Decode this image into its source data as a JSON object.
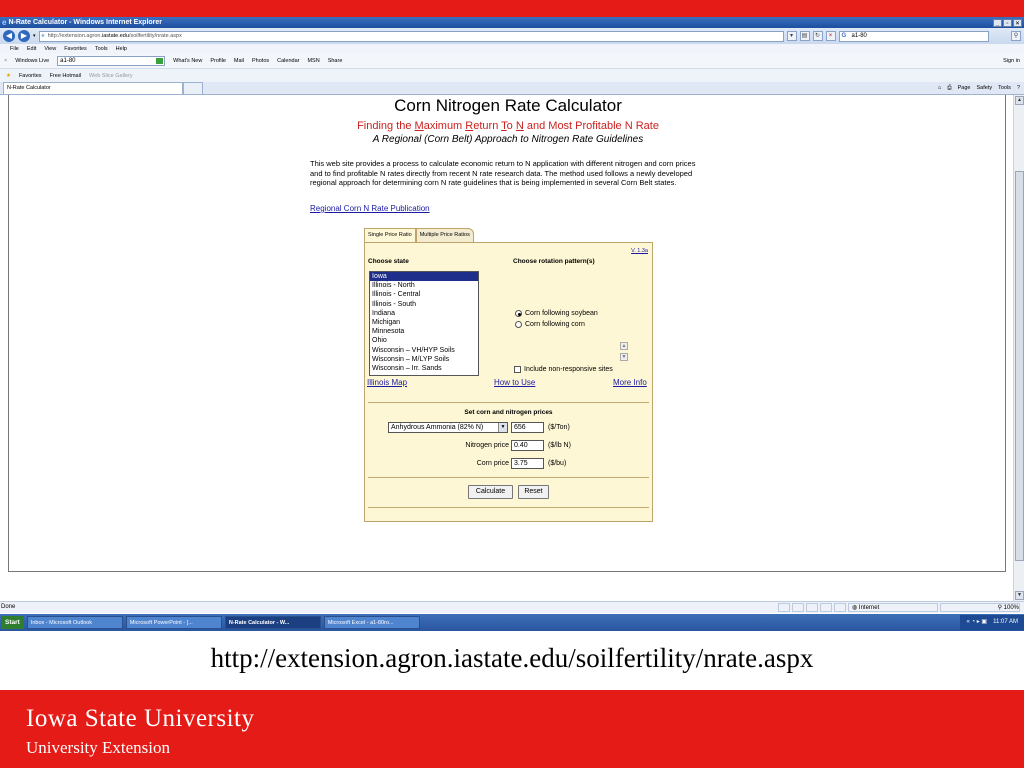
{
  "window": {
    "title": "N-Rate Calculator - Windows Internet Explorer",
    "url_prefix": "http://extension.agron.",
    "url_domain": "iastate.edu",
    "url_suffix": "/soilfertility/nrate.aspx",
    "search_value": "a1-80"
  },
  "menu": [
    "File",
    "Edit",
    "View",
    "Favorites",
    "Tools",
    "Help"
  ],
  "windows_live": {
    "label": "Windows Live",
    "search_value": "a1-80",
    "links": [
      "What's New",
      "Profile",
      "Mail",
      "Photos",
      "Calendar",
      "MSN",
      "Share"
    ],
    "sign_in": "Sign in"
  },
  "favorites": {
    "label": "Favorites",
    "items": [
      "Free Hotmail",
      "Web Slice Gallery"
    ]
  },
  "tab": {
    "label": "N-Rate Calculator",
    "commands": [
      "Page",
      "Safety",
      "Tools"
    ]
  },
  "page": {
    "title": "Corn Nitrogen Rate Calculator",
    "subtitle_html_parts": [
      "Finding the ",
      "M",
      "aximum ",
      "R",
      "eturn ",
      "T",
      "o ",
      "N",
      " and Most Profitable N Rate"
    ],
    "subtitle2": "A Regional (Corn Belt) Approach to Nitrogen Rate Guidelines",
    "intro": "This web site provides a process to calculate economic return to N application with different nitrogen and corn prices and to find profitable N rates directly from recent N rate research data. The method used follows a newly developed regional approach for determining corn N rate guidelines that is being implemented in several Corn Belt states.",
    "publication_link": "Regional Corn N Rate Publication"
  },
  "calculator": {
    "tabs": [
      "Single Price Ratio",
      "Multiple Price Ratios"
    ],
    "version": "V. 1.3a",
    "choose_state_label": "Choose state",
    "states": [
      "Iowa",
      "Illinois - North",
      "Illinois - Central",
      "Illinois - South",
      "Indiana",
      "Michigan",
      "Minnesota",
      "Ohio",
      "Wisconsin – VH/HYP Soils",
      "Wisconsin – M/LYP Soils",
      "Wisconsin – Irr. Sands"
    ],
    "selected_state": "Iowa",
    "rotation_label": "Choose rotation pattern(s)",
    "rotations": [
      "Corn following soybean",
      "Corn following corn"
    ],
    "selected_rotation": "Corn following soybean",
    "nonresponsive_label": "Include non-responsive sites",
    "prices_title": "Set corn and nitrogen prices",
    "fertilizer": "Anhydrous Ammonia (82% N)",
    "fertilizer_price": "656",
    "fertilizer_unit": "($/Ton)",
    "nitrogen_price_label": "Nitrogen price",
    "nitrogen_price": "0.40",
    "nitrogen_unit": "($/lb N)",
    "corn_price_label": "Corn price",
    "corn_price": "3.75",
    "corn_unit": "($/bu)",
    "calculate": "Calculate",
    "reset": "Reset",
    "links": [
      "Illinois Map",
      "How to Use",
      "More Info"
    ]
  },
  "status": {
    "text": "Done",
    "zone": "Internet",
    "zoom": "100%"
  },
  "taskbar": {
    "start": "Start",
    "tasks": [
      "Inbox - Microsoft Outlook",
      "Microsoft PowerPoint - [...",
      "N-Rate Calculator - W...",
      "Microsoft Excel - a1-80ro..."
    ],
    "active_task": "N-Rate Calculator - W...",
    "clock": "11:07 AM"
  },
  "slide": {
    "url_caption": "http://extension.agron.iastate.edu/soilfertility/nrate.aspx",
    "university": "Iowa State University",
    "unit": "University Extension"
  }
}
